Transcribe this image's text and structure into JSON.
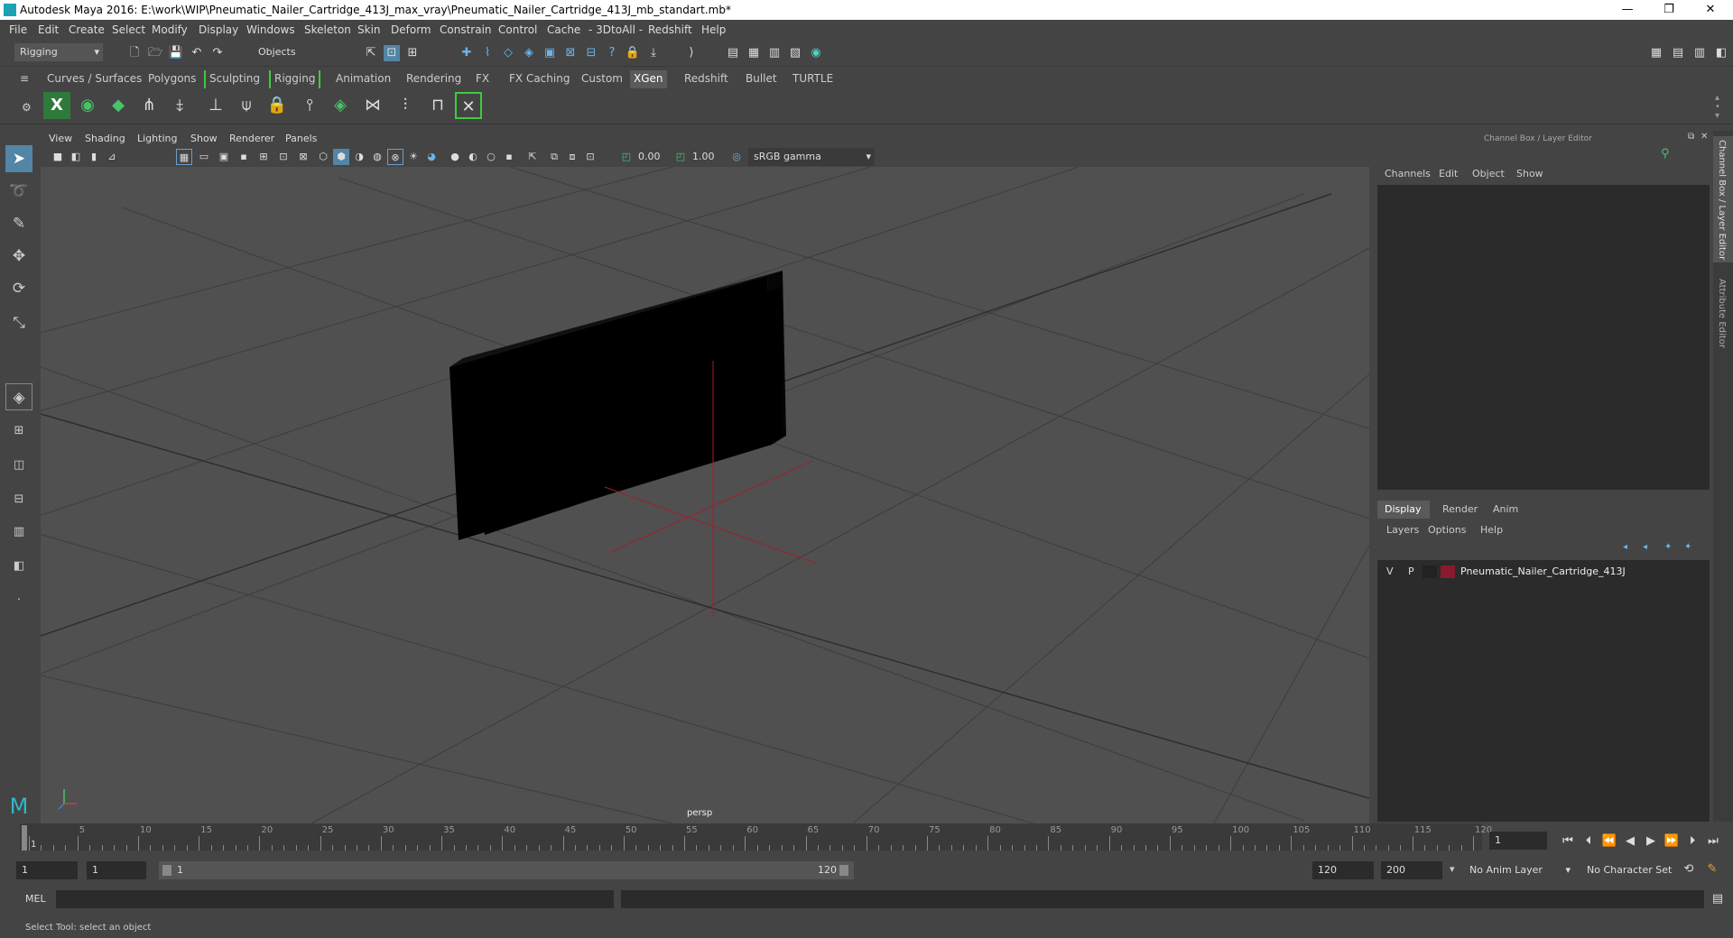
{
  "title": "Autodesk Maya 2016: E:\\work\\WIP\\Pneumatic_Nailer_Cartridge_413J_max_vray\\Pneumatic_Nailer_Cartridge_413J_mb_standart.mb*",
  "window_controls": {
    "minimize": "—",
    "restore": "❐",
    "close": "✕"
  },
  "menu": [
    "File",
    "Edit",
    "Create",
    "Select",
    "Modify",
    "Display",
    "Windows",
    "Skeleton",
    "Skin",
    "Deform",
    "Constrain",
    "Control",
    "Cache",
    "- 3DtoAll -",
    "Redshift",
    "Help"
  ],
  "status": {
    "mode": "Rigging",
    "selection_mode": "Objects"
  },
  "shelf_tabs": [
    "Curves / Surfaces",
    "Polygons",
    "Sculpting",
    "Rigging",
    "Animation",
    "Rendering",
    "FX",
    "FX Caching",
    "Custom",
    "XGen",
    "Redshift",
    "Bullet",
    "TURTLE"
  ],
  "active_shelf_tab": "XGen",
  "viewport_menu": [
    "View",
    "Shading",
    "Lighting",
    "Show",
    "Renderer",
    "Panels"
  ],
  "viewport_toolbar": {
    "exposure": "0.00",
    "gamma": "1.00",
    "color_space": "sRGB gamma"
  },
  "viewport_label": "persp",
  "channel_box": {
    "title": "Channel Box / Layer Editor",
    "menu": [
      "Channels",
      "Edit",
      "Object",
      "Show"
    ],
    "layer_tabs": [
      "Display",
      "Render",
      "Anim"
    ],
    "active_layer_tab": "Display",
    "layer_menu": [
      "Layers",
      "Options",
      "Help"
    ],
    "layers": [
      {
        "v": "V",
        "p": "P",
        "name": "Pneumatic_Nailer_Cartridge_413J",
        "color": "#8b1a2e"
      }
    ]
  },
  "side_tabs": [
    "Channel Box / Layer Editor",
    "Attribute Editor"
  ],
  "timeline": {
    "ticks": [
      "1",
      "5",
      "10",
      "15",
      "20",
      "25",
      "30",
      "35",
      "40",
      "45",
      "50",
      "55",
      "60",
      "65",
      "70",
      "75",
      "80",
      "85",
      "90",
      "95",
      "100",
      "105",
      "110",
      "115",
      "120"
    ],
    "current_frame": "1"
  },
  "range": {
    "start": "1",
    "start_inner": "1",
    "range_start_label": "1",
    "range_end_label": "120",
    "end_inner": "120",
    "end": "200"
  },
  "anim_layer": "No Anim Layer",
  "character_set": "No Character Set",
  "cmd": {
    "label": "MEL"
  },
  "help_text": "Select Tool: select an object",
  "colors": {
    "bg": "#444444",
    "viewport": "#505050",
    "panel": "#2b2b2b",
    "accent": "#5285a6",
    "grid": "#3a3a3a",
    "axis": "#a0202a"
  }
}
